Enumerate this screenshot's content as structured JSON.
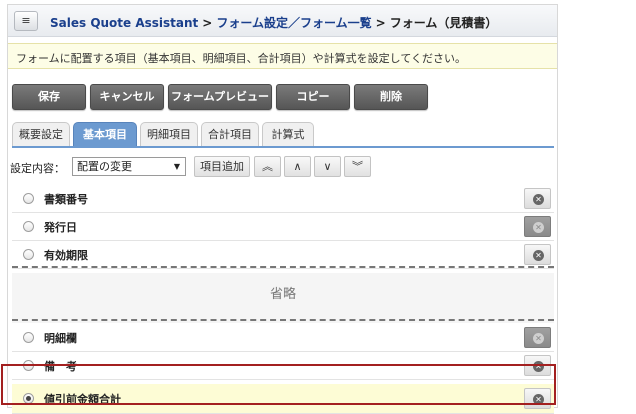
{
  "header": {
    "menu_icon": "≡",
    "app_name": "Sales Quote Assistant",
    "sep": ">",
    "crumb1": "フォーム設定／フォーム一覧",
    "current": "フォーム（見積書）"
  },
  "info": {
    "message": "フォームに配置する項目（基本項目、明細項目、合計項目）や計算式を設定してください。"
  },
  "actions": {
    "save": "保存",
    "cancel": "キャンセル",
    "preview": "フォームプレビュー",
    "copy": "コピー",
    "delete": "削除"
  },
  "tabs": [
    {
      "label": "概要設定",
      "active": false
    },
    {
      "label": "基本項目",
      "active": true
    },
    {
      "label": "明細項目",
      "active": false
    },
    {
      "label": "合計項目",
      "active": false
    },
    {
      "label": "計算式",
      "active": false
    }
  ],
  "toolbar": {
    "label": "設定内容：",
    "select_value": "配置の変更",
    "add_item": "項目追加",
    "move_top": "︽",
    "move_up": "∧",
    "move_down": "∨",
    "move_bottom": "︾"
  },
  "rows_top": [
    {
      "label": "書類番号"
    },
    {
      "label": "発行日"
    },
    {
      "label": "有効期限"
    }
  ],
  "omitted_label": "省略",
  "rows_bottom": [
    {
      "label": "明細欄"
    },
    {
      "label": "備　考"
    },
    {
      "label": "値引前金額合計"
    }
  ],
  "colors": {
    "accent": "#6c9ad0",
    "link": "#1a3f8c",
    "highlight_border": "#a32020",
    "selected_row": "#fdfcd5"
  }
}
